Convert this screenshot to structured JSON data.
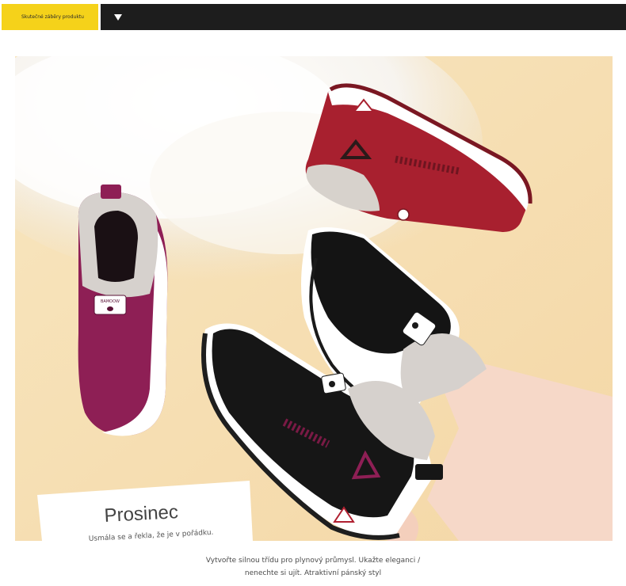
{
  "header": {
    "tag_label": "Skutečné záběry produktu",
    "toggle_icon": "triangle-down-icon",
    "accent_color": "#f5d21a",
    "bar_color": "#1d1d1d"
  },
  "photo": {
    "card_title": "Prosinec",
    "card_subtitle": "Usmála se a řekla, že je v pořádku.",
    "shoe_badge_text": "BAMOOW"
  },
  "caption": {
    "line1": "Vytvořte silnou třídu pro plynový průmysl. Ukažte eleganci /",
    "line2": "nenechte si ujít. Atraktivní pánský styl"
  }
}
